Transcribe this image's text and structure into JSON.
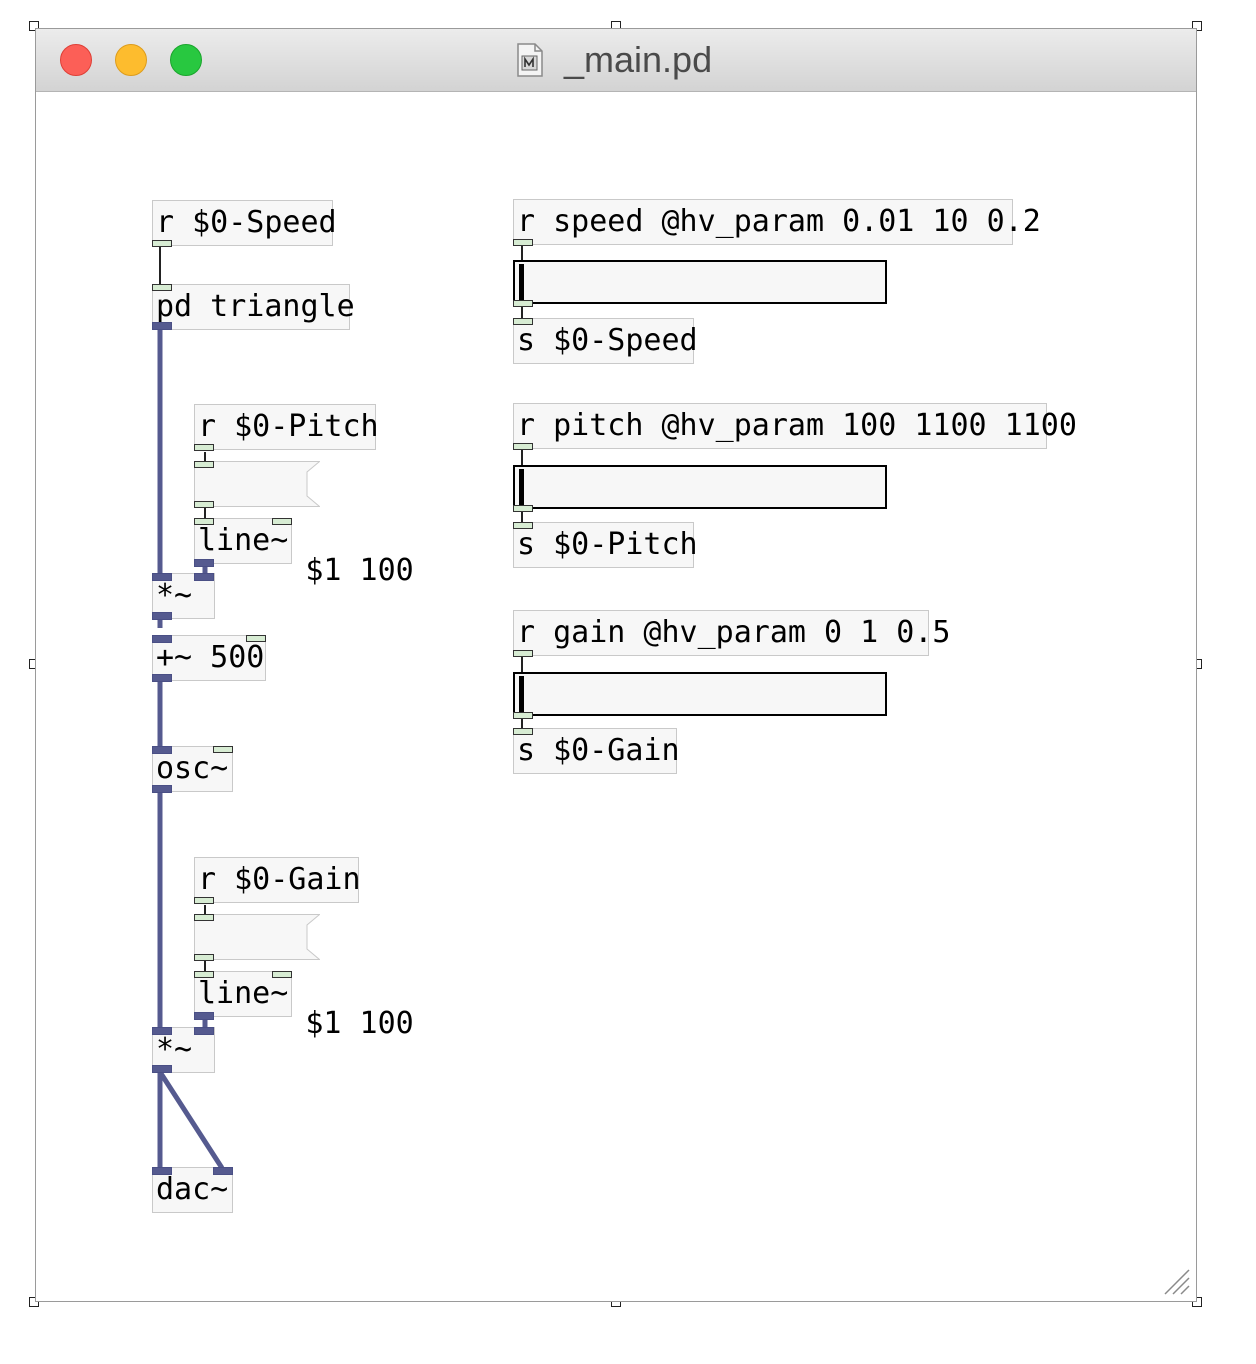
{
  "window": {
    "title": "_main.pd"
  },
  "patch": {
    "objects": {
      "r_speed_local": "r $0-Speed",
      "pd_triangle": "pd triangle",
      "r_pitch_local": "r $0-Pitch",
      "msg_pitch": "$1 100",
      "line_pitch": "line~",
      "mul_pitch": "*~",
      "add_500": "+~ 500",
      "osc": "osc~",
      "r_gain_local": "r $0-Gain",
      "msg_gain": "$1 100",
      "line_gain": "line~",
      "mul_gain": "*~",
      "dac": "dac~",
      "r_speed_param": "r speed @hv_param 0.01 10 0.2",
      "s_speed": "s $0-Speed",
      "r_pitch_param": "r pitch @hv_param 100 1100 1100",
      "s_pitch": "s $0-Pitch",
      "r_gain_param": "r gain @hv_param 0 1 0.5",
      "s_gain": "s $0-Gain"
    },
    "sliders": {
      "speed": 0,
      "pitch": 0,
      "gain": 0
    }
  },
  "colors": {
    "signal_wire": "#555a8f",
    "control_wire": "#222222",
    "object_border": "#c9c9c9",
    "object_fill": "#f7f7f7"
  }
}
